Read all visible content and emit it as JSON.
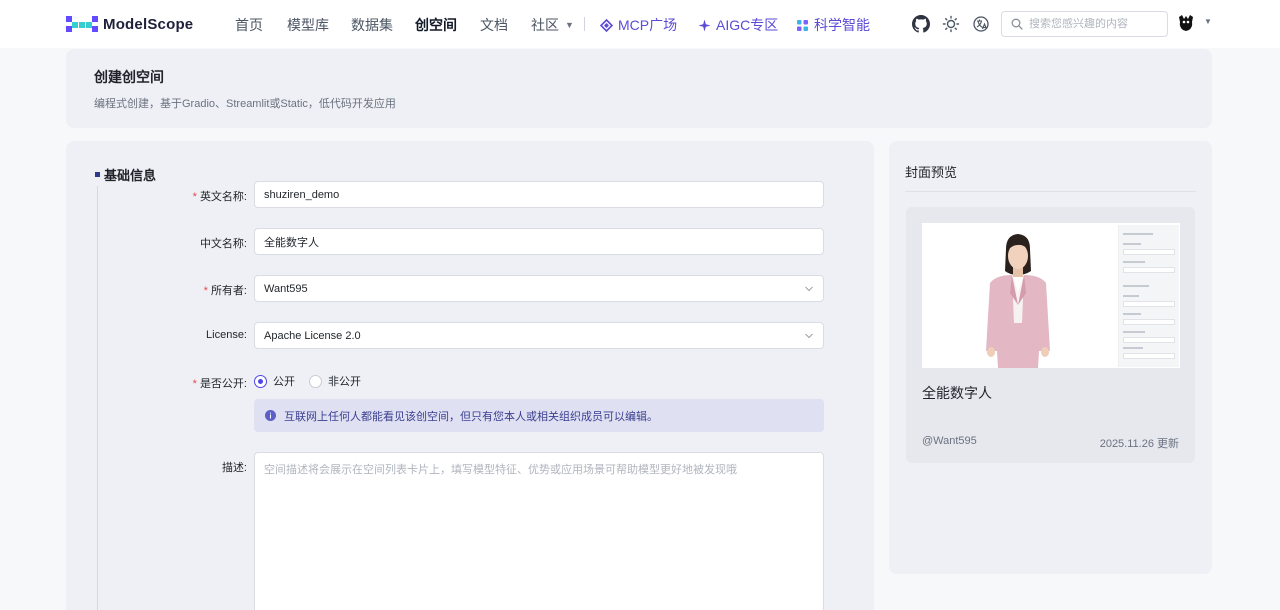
{
  "nav": {
    "logo_text": "ModelScope",
    "items": [
      "首页",
      "模型库",
      "数据集",
      "创空间",
      "文档",
      "社区"
    ],
    "active_item": "创空间",
    "mcp": "MCP广场",
    "aigc": "AIGC专区",
    "science": "科学智能",
    "search_placeholder": "搜索您感兴趣的内容",
    "icons": [
      "github-icon",
      "theme-sun-icon",
      "language-icon",
      "search-icon"
    ],
    "accent_color": "#5b4bd6"
  },
  "header": {
    "title": "创建创空间",
    "subtitle": "编程式创建，基于Gradio、Streamlit或Static，低代码开发应用"
  },
  "form": {
    "section_title": "基础信息",
    "english_name": {
      "label": "英文名称:",
      "required": true,
      "value": "shuziren_demo"
    },
    "chinese_name": {
      "label": "中文名称:",
      "required": false,
      "value": "全能数字人"
    },
    "owner": {
      "label": "所有者:",
      "required": true,
      "value": "Want595"
    },
    "license": {
      "label": "License:",
      "required": false,
      "value": "Apache License 2.0"
    },
    "visibility": {
      "label": "是否公开:",
      "required": true,
      "options": [
        "公开",
        "非公开"
      ],
      "selected": "公开",
      "info": "互联网上任何人都能看见该创空间，但只有您本人或相关组织成员可以编辑。"
    },
    "description": {
      "label": "描述:",
      "value": "",
      "placeholder": "空间描述将会展示在空间列表卡片上，填写模型特征、优势或应用场景可帮助模型更好地被发现哦"
    }
  },
  "preview": {
    "title": "封面预览",
    "card_name": "全能数字人",
    "owner": "@Want595",
    "date": "2025.11.26 更新"
  }
}
